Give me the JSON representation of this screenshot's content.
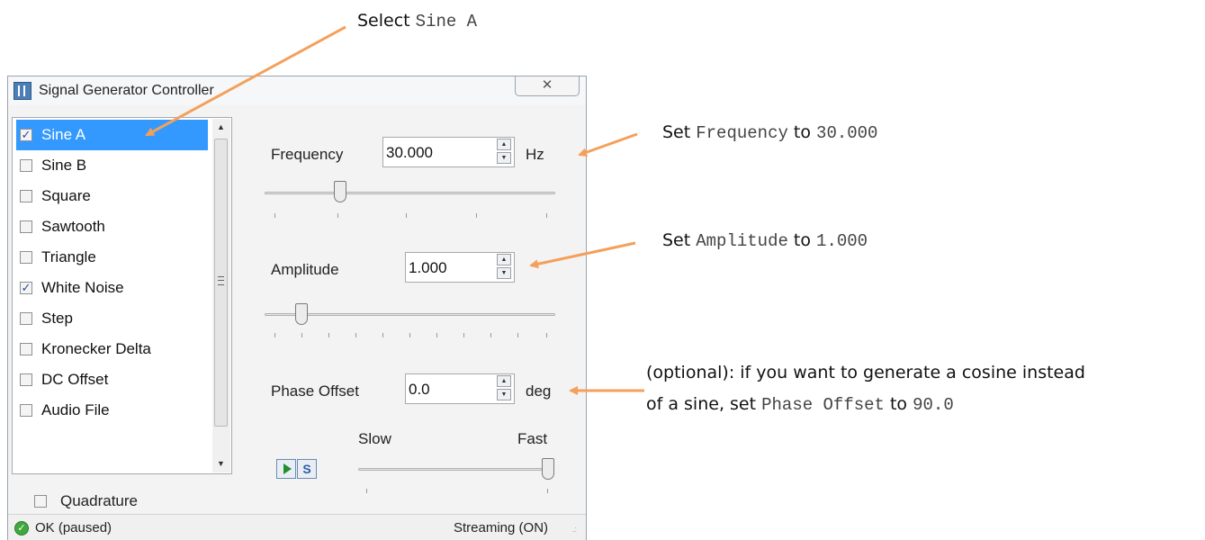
{
  "window": {
    "title": "Signal Generator Controller",
    "close_glyph": "✕"
  },
  "signals": [
    {
      "label": "Sine A",
      "checked": true,
      "selected": true
    },
    {
      "label": "Sine B",
      "checked": false,
      "selected": false
    },
    {
      "label": "Square",
      "checked": false,
      "selected": false
    },
    {
      "label": "Sawtooth",
      "checked": false,
      "selected": false
    },
    {
      "label": "Triangle",
      "checked": false,
      "selected": false
    },
    {
      "label": "White Noise",
      "checked": true,
      "selected": false
    },
    {
      "label": "Step",
      "checked": false,
      "selected": false
    },
    {
      "label": "Kronecker Delta",
      "checked": false,
      "selected": false
    },
    {
      "label": "DC Offset",
      "checked": false,
      "selected": false
    },
    {
      "label": "Audio File",
      "checked": false,
      "selected": false
    }
  ],
  "quadrature": {
    "label": "Quadrature",
    "checked": false
  },
  "frequency": {
    "label": "Frequency",
    "value": "30.000",
    "unit": "Hz",
    "slider_level": 0.25
  },
  "amplitude": {
    "label": "Amplitude",
    "value": "1.000",
    "slider_level": 0.11
  },
  "phase_offset": {
    "label": "Phase Offset",
    "value": "0.0",
    "unit": "deg"
  },
  "speed": {
    "slow_label": "Slow",
    "fast_label": "Fast",
    "slider_level": 1.0
  },
  "status": {
    "left": "OK (paused)",
    "right": "Streaming (ON)"
  },
  "annotations": {
    "select": {
      "prefix": "Select",
      "code": "Sine A"
    },
    "frequency": {
      "prefix": "Set",
      "code": "Frequency",
      "mid": "to",
      "value": "30.000"
    },
    "amplitude": {
      "prefix": "Set",
      "code": "Amplitude",
      "mid": "to",
      "value": "1.000"
    },
    "phase_line1": "(optional): if you want to generate a cosine instead",
    "phase_line2_prefix": "of a sine, set",
    "phase_code": "Phase Offset",
    "phase_mid": "to",
    "phase_value": "90.0"
  },
  "colors": {
    "arrow": "#f4a05a",
    "selection": "#3399ff"
  }
}
